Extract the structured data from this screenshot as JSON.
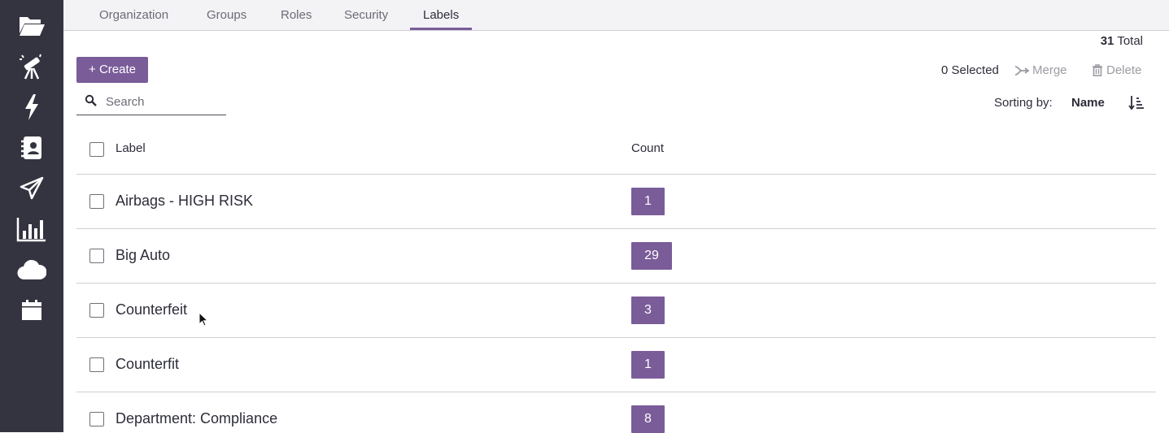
{
  "sidebar": {
    "icons": [
      "folder-open-icon",
      "telescope-icon",
      "lightning-icon",
      "contacts-book-icon",
      "paper-plane-icon",
      "bar-chart-icon",
      "cloud-icon",
      "calendar-icon"
    ]
  },
  "tabs": [
    {
      "label": "Organization",
      "active": false
    },
    {
      "label": "Groups",
      "active": false
    },
    {
      "label": "Roles",
      "active": false
    },
    {
      "label": "Security",
      "active": false
    },
    {
      "label": "Labels",
      "active": true
    }
  ],
  "summary": {
    "total_count": "31",
    "total_label": "Total"
  },
  "toolbar": {
    "create_label": "+ Create",
    "selected_label": "0 Selected",
    "merge_label": "Merge",
    "delete_label": "Delete"
  },
  "search": {
    "placeholder": "Search",
    "value": ""
  },
  "sorting": {
    "label": "Sorting by:",
    "value": "Name"
  },
  "table": {
    "columns": {
      "label": "Label",
      "count": "Count"
    },
    "rows": [
      {
        "label": "Airbags - HIGH RISK",
        "count": "1"
      },
      {
        "label": "Big Auto",
        "count": "29"
      },
      {
        "label": "Counterfeit",
        "count": "3"
      },
      {
        "label": "Counterfit",
        "count": "1"
      },
      {
        "label": "Department: Compliance",
        "count": "8"
      }
    ]
  },
  "colors": {
    "accent": "#7a5c99",
    "sidebar": "#343340"
  }
}
